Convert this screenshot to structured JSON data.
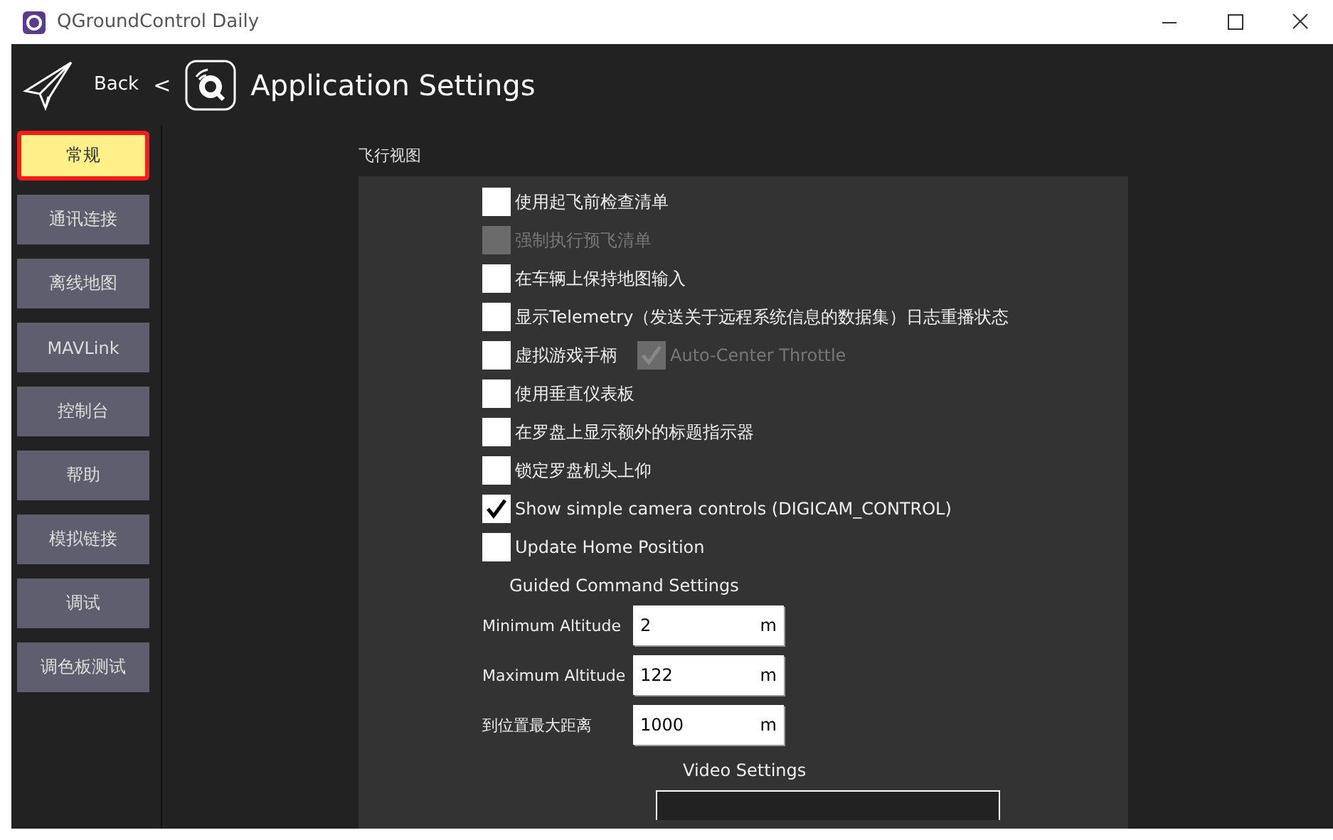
{
  "window": {
    "title": "QGroundControl Daily"
  },
  "toolbar": {
    "back": "Back",
    "separator": "<",
    "title": "Application Settings"
  },
  "sidebar": {
    "items": [
      {
        "label": "常规",
        "selected": true
      },
      {
        "label": "通讯连接",
        "selected": false
      },
      {
        "label": "离线地图",
        "selected": false
      },
      {
        "label": "MAVLink",
        "selected": false
      },
      {
        "label": "控制台",
        "selected": false
      },
      {
        "label": "帮助",
        "selected": false
      },
      {
        "label": "模拟链接",
        "selected": false
      },
      {
        "label": "调试",
        "selected": false
      },
      {
        "label": "调色板测试",
        "selected": false
      }
    ]
  },
  "section": {
    "title": "飞行视图",
    "options": [
      {
        "label": "使用起飞前检查清单",
        "checked": false,
        "disabled": false
      },
      {
        "label": "强制执行预飞清单",
        "checked": false,
        "disabled": true
      },
      {
        "label": "在车辆上保持地图输入",
        "checked": false,
        "disabled": false
      },
      {
        "label": "显示Telemetry（发送关于远程系统信息的数据集）日志重播状态",
        "checked": false,
        "disabled": false
      },
      {
        "label": "虚拟游戏手柄",
        "checked": false,
        "disabled": false,
        "extra": {
          "label": "Auto-Center Throttle",
          "checked": true,
          "disabled": true
        }
      },
      {
        "label": "使用垂直仪表板",
        "checked": false,
        "disabled": false
      },
      {
        "label": "在罗盘上显示额外的标题指示器",
        "checked": false,
        "disabled": false
      },
      {
        "label": "锁定罗盘机头上仰",
        "checked": false,
        "disabled": false
      },
      {
        "label": "Show simple camera controls (DIGICAM_CONTROL)",
        "checked": true,
        "disabled": false
      },
      {
        "label": "Update Home Position",
        "checked": false,
        "disabled": false
      }
    ],
    "guided": {
      "title": "Guided Command Settings",
      "fields": [
        {
          "label": "Minimum Altitude",
          "value": "2",
          "unit": "m"
        },
        {
          "label": "Maximum Altitude",
          "value": "122",
          "unit": "m"
        },
        {
          "label": "到位置最大距离",
          "value": "1000",
          "unit": "m"
        }
      ]
    },
    "video": {
      "title": "Video Settings"
    }
  }
}
